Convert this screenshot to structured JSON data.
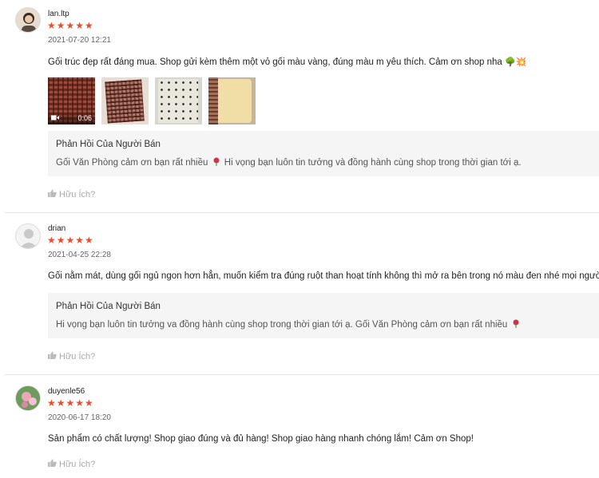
{
  "reviews": [
    {
      "username": "lan.ltp",
      "stars": "★★★★★",
      "date": "2021-07-20 12:21",
      "comment": "Gối trúc đẹp rất đáng mua. Shop gửi kèm thêm một vỏ gối màu vàng, đúng màu m yêu thích. Cảm ơn shop nha",
      "comment_emojis": "🌳💥",
      "video_duration": "0:06",
      "seller_title": "Phản Hồi Của Người Bán",
      "seller_text_a": "Gối Văn Phòng cảm ơn bạn rất nhiều",
      "seller_text_b": "Hi vọng bạn luôn tin tưởng và đồng hành cùng shop trong thời gian tới ạ.",
      "helpful": "Hữu Ích?"
    },
    {
      "username": "drian",
      "stars": "★★★★★",
      "date": "2021-04-25 22:28",
      "comment": "Gối nằm mát, dùng gối ngủ ngon hơn hẳn, muốn kiểm tra đúng ruột than hoạt tính không thì mở ra bên trong nó màu đen nhé mọi người",
      "seller_title": "Phản Hồi Của Người Bán",
      "seller_text_a": "Hi vọng bạn luôn tin tưởng va đồng hành cùng shop trong thời gian tới ạ. Gối Văn Phòng cảm ơn bạn rất nhiều",
      "helpful": "Hữu Ích?"
    },
    {
      "username": "duyenle56",
      "stars": "★★★★★",
      "date": "2020-06-17 18:20",
      "comment": "Sản phẩm có chất lượng! Shop giao đúng và đủ hàng! Shop giao hàng nhanh chóng lắm! Cảm ơn Shop!",
      "helpful": "Hữu Ích?"
    }
  ],
  "colors": {
    "star": "#ee4d2d",
    "seller_bg": "#f5f5f5"
  },
  "icons": {
    "helpful": "thumbs-up-icon",
    "rose": "rose-icon",
    "video": "video-camera-icon"
  }
}
